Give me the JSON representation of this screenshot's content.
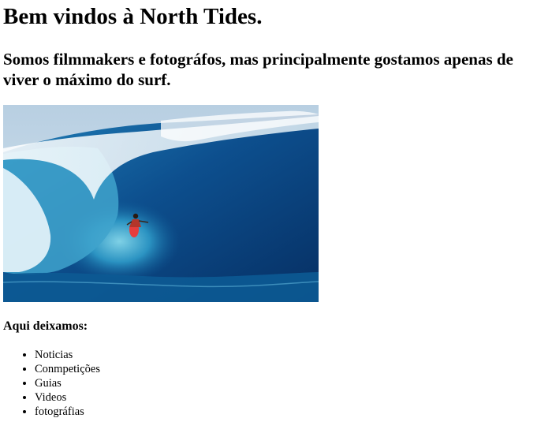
{
  "header": {
    "title": "Bem vindos à North Tides.",
    "subtitle": "Somos filmmakers e fotográfos, mas principalmente gostamos apenas de viver o máximo do surf."
  },
  "hero": {
    "icon": "surf-wave-photo",
    "colors": {
      "sky": "#c9dbe8",
      "wave_dark": "#0a3f78",
      "wave_mid": "#1b6fa8",
      "foam": "#e8f4fa",
      "board": "#e63d3d"
    }
  },
  "content": {
    "section_heading": "Aqui deixamos:",
    "items": [
      "Noticias",
      "Conmpetições",
      "Guias",
      "Videos",
      "fotográfias"
    ]
  }
}
